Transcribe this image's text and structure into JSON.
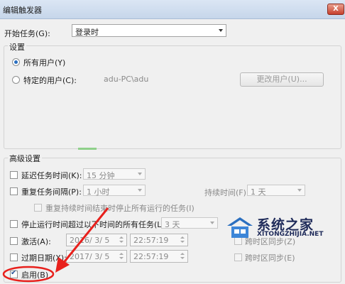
{
  "window": {
    "title": "编辑触发器",
    "close_label": "X"
  },
  "begin_task": {
    "label": "开始任务(G):",
    "value": "登录时"
  },
  "settings": {
    "group_label": "设置",
    "all_users_label": "所有用户(Y)",
    "specific_user_label": "特定的用户(C):",
    "user_value": "adu-PC\\adu",
    "change_user_button": "更改用户(U)..."
  },
  "advanced": {
    "group_label": "高级设置",
    "delay_label": "延迟任务时间(K):",
    "delay_value": "15 分钟",
    "repeat_label": "重复任务间隔(P):",
    "repeat_value": "1 小时",
    "duration_label": "持续时间(F):",
    "duration_value": "1 天",
    "stop_all_label": "重复持续时间结束时停止所有运行的任务(I)",
    "stop_after_label": "停止运行时间超过以下时间的所有任务(L):",
    "stop_after_value": "3 天",
    "activate_label": "激活(A):",
    "activate_date": "2016/ 3/  5",
    "activate_time": "22:57:19",
    "activate_sync_label": "跨时区同步(Z)",
    "expire_label": "过期日期(X):",
    "expire_date": "2017/ 3/  5",
    "expire_time": "22:57:19",
    "expire_sync_label": "跨时区同步(E)",
    "enabled_label": "启用(B)"
  },
  "watermark": {
    "brand": "系统之家",
    "url": "XITONGZHIJIA.NET"
  },
  "annotation_color": "#e8201c"
}
